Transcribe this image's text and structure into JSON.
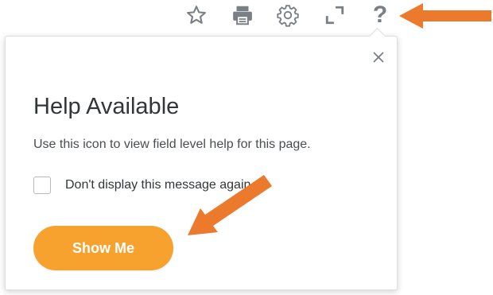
{
  "toolbar": {
    "icons": [
      "star-icon",
      "print-icon",
      "gear-icon",
      "expand-icon",
      "help-icon"
    ],
    "help_glyph": "?",
    "icon_color": "#7a7f85"
  },
  "popup": {
    "title": "Help Available",
    "body": "Use this icon to view field level help for this page.",
    "checkbox_label": "Don't display this message again",
    "checkbox_checked": false,
    "button_label": "Show Me",
    "button_color": "#f7a22f",
    "close_icon": "close-icon"
  },
  "annotations": {
    "arrow_color": "#ec7a2d"
  }
}
